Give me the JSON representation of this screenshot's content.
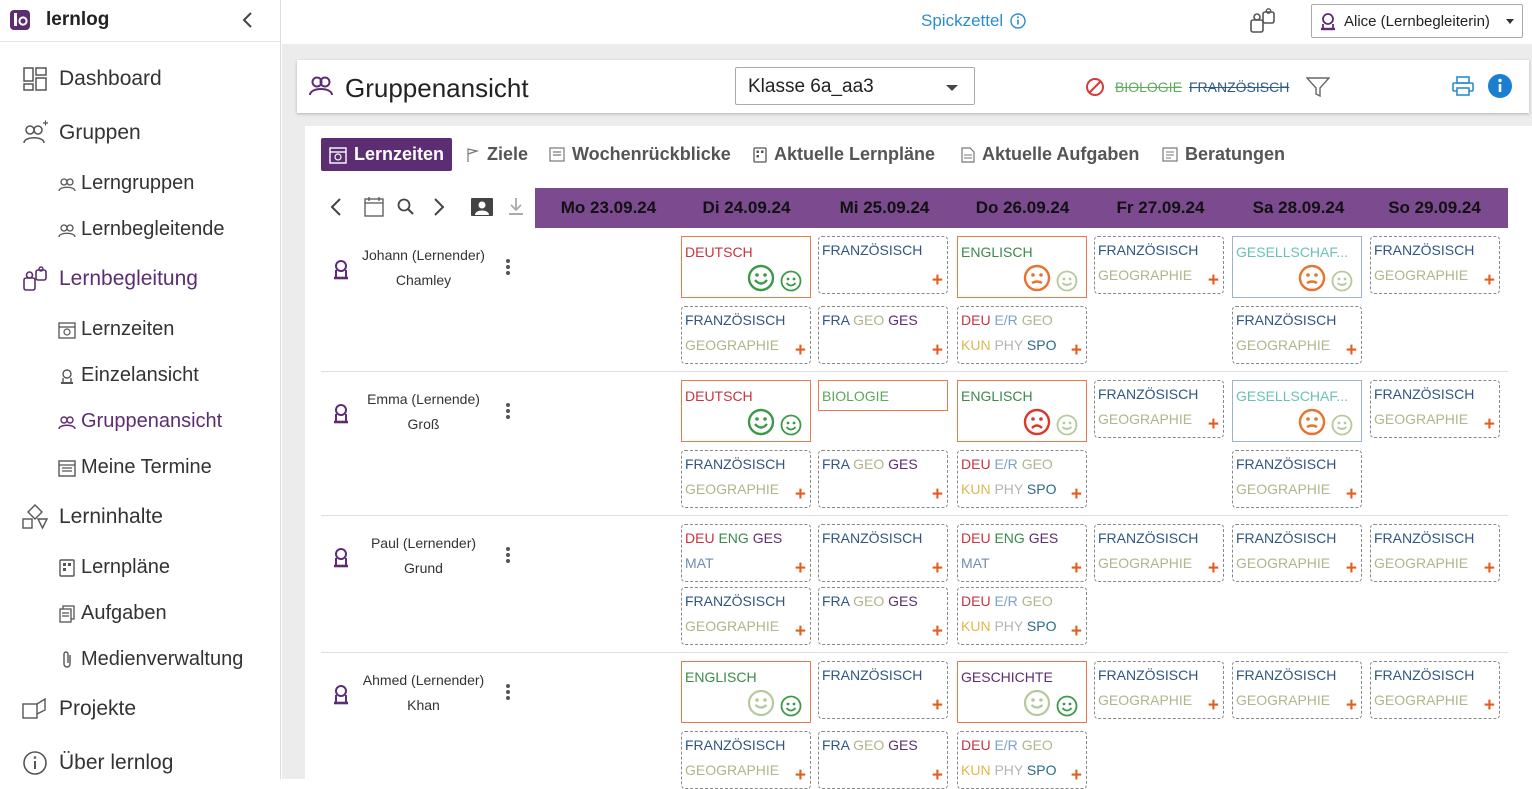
{
  "sidebar": {
    "brand": "lernlog",
    "items": {
      "dashboard": "Dashboard",
      "gruppen": "Gruppen",
      "lerngruppen": "Lerngruppen",
      "lernbegleitende": "Lernbegleitende",
      "lernbegleitung": "Lernbegleitung",
      "lernzeiten": "Lernzeiten",
      "einzelansicht": "Einzelansicht",
      "gruppenansicht": "Gruppenansicht",
      "termine": "Meine Termine",
      "lerninhalte": "Lerninhalte",
      "lernplaene": "Lernpläne",
      "aufgaben": "Aufgaben",
      "medien": "Medienverwaltung",
      "projekte": "Projekte",
      "ueber": "Über lernlog"
    }
  },
  "topbar": {
    "spickzettel": "Spickzettel",
    "user": "Alice (Lernbegleiterin)"
  },
  "header": {
    "title": "Gruppenansicht",
    "class_select": "Klasse 6a_aa3",
    "filter_excluded": [
      "BIOLOGIE",
      "FRANZÖSISCH"
    ]
  },
  "tabs": {
    "lernzeiten": "Lernzeiten",
    "ziele": "Ziele",
    "wochen": "Wochenrückblicke",
    "plaene": "Aktuelle Lernpläne",
    "aufgaben": "Aktuelle Aufgaben",
    "beratungen": "Beratungen"
  },
  "days": [
    "Mo 23.09.24",
    "Di 24.09.24",
    "Mi 25.09.24",
    "Do 26.09.24",
    "Fr 27.09.24",
    "Sa 28.09.24",
    "So 29.09.24"
  ],
  "students": [
    {
      "name": "Johann (Lernender)",
      "surname": "Chamley"
    },
    {
      "name": "Emma (Lernende)",
      "surname": "Groß"
    },
    {
      "name": "Paul (Lernender)",
      "surname": "Grund"
    },
    {
      "name": "Ahmed (Lernender)",
      "surname": "Khan"
    }
  ],
  "subjects": {
    "deutsch": "DEUTSCH",
    "franzoesisch": "FRANZÖSISCH",
    "geographie": "GEOGRAPHIE",
    "englisch": "ENGLISCH",
    "gesellschaft": "GESELLSCHAF...",
    "biologie": "BIOLOGIE",
    "geschichte": "GESCHICHTE",
    "fra": "FRA",
    "geo": "GEO",
    "ges": "GES",
    "deu": "DEU",
    "er": "E/R",
    "kun": "KUN",
    "phy": "PHY",
    "spo": "SPO",
    "eng": "ENG",
    "mat": "MAT"
  },
  "plus": "+",
  "colors": {
    "accent": "#5c2d72",
    "day_header": "#7b4a8f",
    "plus": "#e35d1f",
    "link": "#2a8ed1"
  }
}
